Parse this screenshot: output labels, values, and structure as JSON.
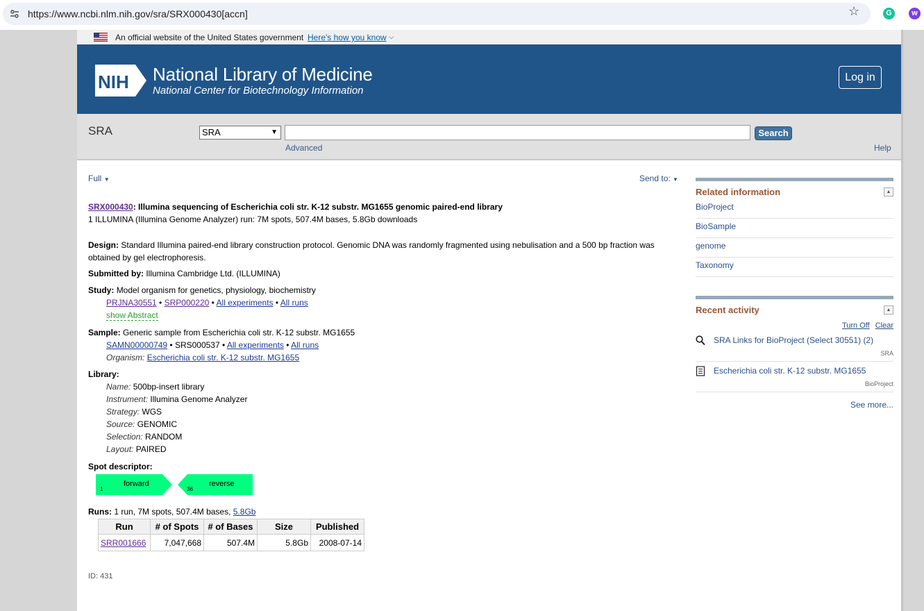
{
  "browser": {
    "url": "https://www.ncbi.nlm.nih.gov/sra/SRX000430[accn]",
    "ext1": "G",
    "ext2": "w"
  },
  "gov_banner": {
    "text": "An official website of the United States government",
    "link": "Here's how you know"
  },
  "header": {
    "logo_text": "NIH",
    "title": "National Library of Medicine",
    "subtitle": "National Center for Biotechnology Information",
    "login": "Log in"
  },
  "searchbar": {
    "db_title": "SRA",
    "db_selected": "SRA",
    "search_value": "",
    "search_button": "Search",
    "advanced": "Advanced",
    "help": "Help"
  },
  "toolbar": {
    "format": "Full",
    "send_to": "Send to:"
  },
  "record": {
    "accession": "SRX000430",
    "title": ": Illumina sequencing of Escherichia coli str. K-12 substr. MG1655 genomic paired-end library",
    "summary": "1 ILLUMINA (Illumina Genome Analyzer) run: 7M spots, 507.4M bases, 5.8Gb downloads",
    "design_label": "Design:",
    "design": "Standard Illumina paired-end library construction protocol. Genomic DNA was randomly fragmented using nebulisation and a 500 bp fraction was obtained by gel electrophoresis.",
    "submitted_label": "Submitted by:",
    "submitted": "Illumina Cambridge Ltd. (ILLUMINA)",
    "study_label": "Study:",
    "study": "Model organism for genetics, physiology, biochemistry",
    "study_links": {
      "bioproject": "PRJNA30551",
      "srp": "SRP000220",
      "all_experiments": "All experiments",
      "all_runs": "All runs",
      "show_abstract": "show Abstract"
    },
    "sample_label": "Sample:",
    "sample": "Generic sample from Escherichia coli str. K-12 substr. MG1655",
    "sample_links": {
      "biosample": "SAMN00000749",
      "srs": "SRS000537",
      "all_experiments": "All experiments",
      "all_runs": "All runs"
    },
    "organism_label": "Organism:",
    "organism": "Escherichia coli str. K-12 substr. MG1655",
    "library_label": "Library:",
    "library": {
      "name_label": "Name:",
      "name": "500bp-insert library",
      "instrument_label": "Instrument:",
      "instrument": "Illumina Genome Analyzer",
      "strategy_label": "Strategy:",
      "strategy": "WGS",
      "source_label": "Source:",
      "source": "GENOMIC",
      "selection_label": "Selection:",
      "selection": "RANDOM",
      "layout_label": "Layout:",
      "layout": "PAIRED"
    },
    "spot_label": "Spot descriptor:",
    "spot": {
      "forward_label": "forward",
      "forward_pos": "1",
      "reverse_label": "reverse",
      "reverse_pos": "36",
      "color": "#00ff7f"
    },
    "runs_label": "Runs:",
    "runs_summary": "1 run, 7M spots, 507.4M bases,",
    "runs_size_link": "5.8Gb",
    "runs_table": {
      "headers": [
        "Run",
        "# of Spots",
        "# of Bases",
        "Size",
        "Published"
      ],
      "rows": [
        [
          "SRR001666",
          "7,047,668",
          "507.4M",
          "5.8Gb",
          "2008-07-14"
        ]
      ]
    },
    "id": "ID: 431"
  },
  "sidebar": {
    "related_title": "Related information",
    "related": [
      "BioProject",
      "BioSample",
      "genome",
      "Taxonomy"
    ],
    "recent_title": "Recent activity",
    "turn_off": "Turn Off",
    "clear": "Clear",
    "recent": [
      {
        "text": "SRA Links for BioProject (Select 30551) (2)",
        "db": "SRA",
        "icon": "search-icon"
      },
      {
        "text": "Escherichia coli str. K-12 substr. MG1655",
        "db": "BioProject",
        "icon": "document-icon"
      }
    ],
    "see_more": "See more..."
  },
  "colors": {
    "header_bg": "#20558a",
    "section_title": "#985735",
    "link": "#1f3a93",
    "spot_green": "#00ff7f"
  }
}
